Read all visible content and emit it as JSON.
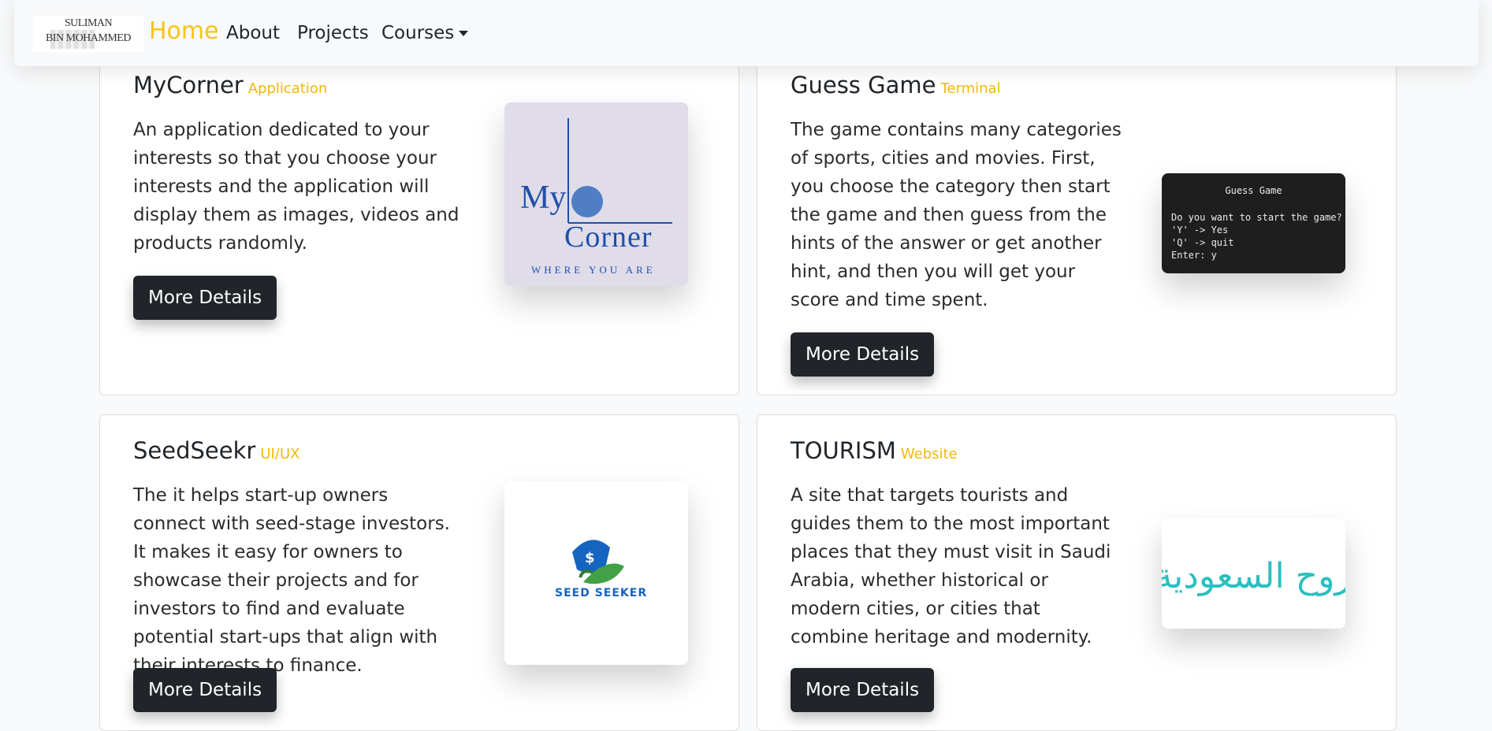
{
  "nav": {
    "logo_line1": "SULIMAN",
    "logo_line2": "BIN MOHAMMED",
    "home": "Home",
    "about": "About",
    "projects": "Projects",
    "courses": "Courses"
  },
  "projects": [
    {
      "title": "MyCorner",
      "tag": "Application",
      "description": "An application dedicated to your interests so that you choose your interests and the application will display them as images, videos and products randomly.",
      "button": "More Details",
      "image": {
        "text_my": "My",
        "text_corner": "Corner",
        "tagline": "WHERE YOU ARE"
      }
    },
    {
      "title": "Guess Game",
      "tag": "Terminal",
      "description": "The game contains many categories of sports, cities and movies. First, you choose the category then start the game and then guess from the hints of the answer or get another hint, and then you will get your score and time spent.",
      "button": "More Details",
      "image": {
        "title": "Guess Game",
        "prompt": "Do you want to start the game?",
        "opt_yes": "'Y' -> Yes",
        "opt_quit": "'Q' -> quit",
        "enter": "Enter: y"
      }
    },
    {
      "title": "SeedSeekr",
      "tag": "UI/UX",
      "description": "The it helps start-up owners connect with seed-stage investors. It makes it easy for owners to showcase their projects and for investors to find and evaluate potential start-ups that align with their interests to finance.",
      "button": "More Details",
      "image": {
        "text": "SEED SEEKER",
        "symbol": "$"
      }
    },
    {
      "title": "TOURISM",
      "tag": "Website",
      "description": "A site that targets tourists and guides them to the most important places that they must visit in Saudi Arabia, whether historical or modern cities, or cities that combine heritage and modernity.",
      "button": "More Details",
      "image": {
        "text": "روح السعودية"
      }
    }
  ],
  "colors": {
    "accent": "#f5c518",
    "tag": "#f0b90b",
    "button": "#212529",
    "mycorner_blue": "#1f4fa8",
    "seed_blue": "#1565c0",
    "seed_green": "#43a047",
    "tourism_teal": "#2bbfc0"
  }
}
